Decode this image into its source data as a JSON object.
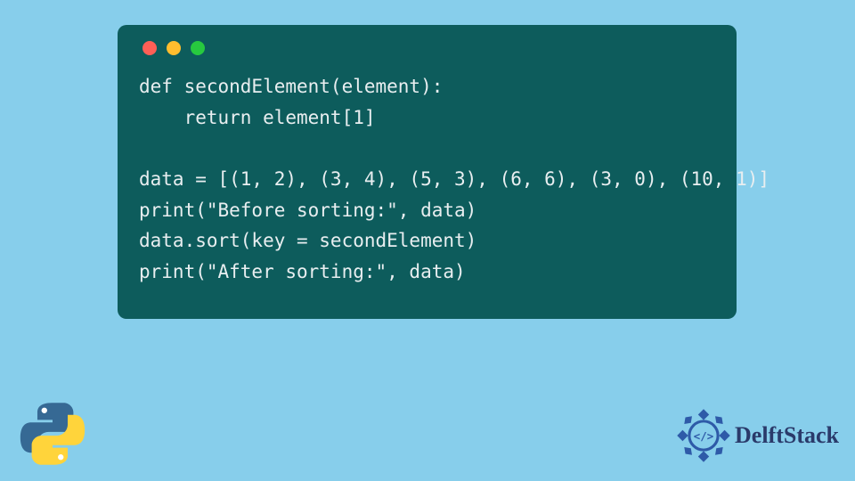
{
  "code": {
    "line1": "def secondElement(element):",
    "line2": "    return element[1]",
    "line3": "",
    "line4": "data = [(1, 2), (3, 4), (5, 3), (6, 6), (3, 0), (10, 1)]",
    "line5": "print(\"Before sorting:\", data)",
    "line6": "data.sort(key = secondElement)",
    "line7": "print(\"After sorting:\", data)"
  },
  "window": {
    "dot_red": "#ff5f56",
    "dot_yellow": "#ffbd2e",
    "dot_green": "#27c93f",
    "bg": "#0d5c5c"
  },
  "branding": {
    "name": "DelftStack",
    "python_icon": "python-logo",
    "ds_icon": "delftstack-badge"
  },
  "colors": {
    "page_bg": "#87ceeb",
    "code_fg": "#e8eef0",
    "brand_text": "#2a3a6a",
    "python_blue": "#366994",
    "python_yellow": "#ffd43b",
    "ds_blue": "#2e5aa8"
  }
}
